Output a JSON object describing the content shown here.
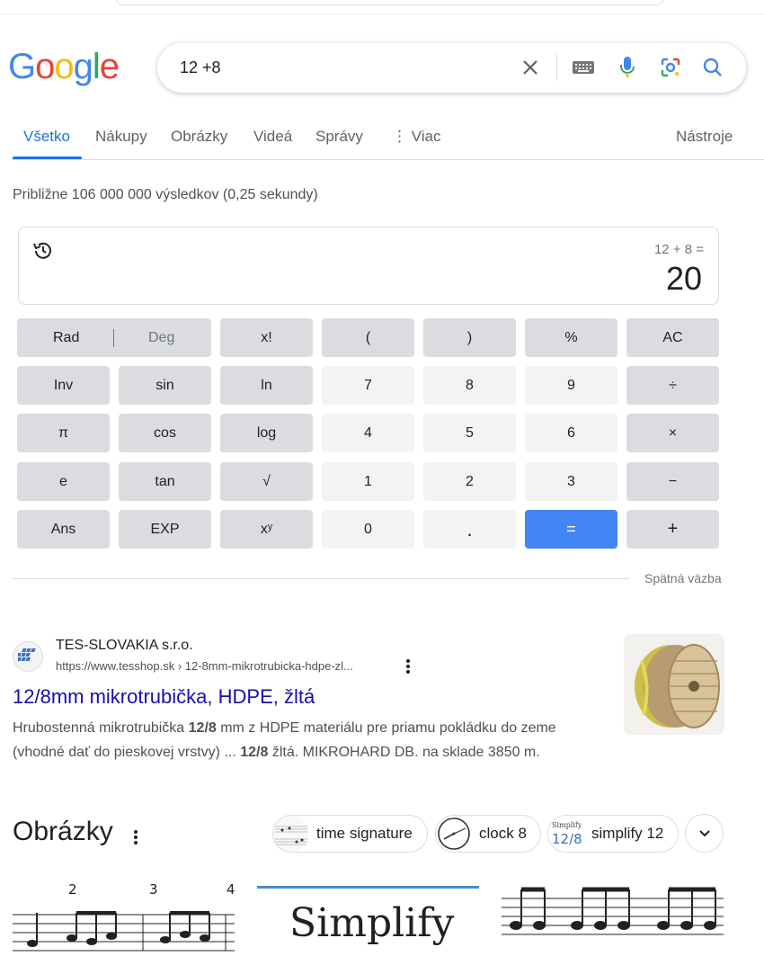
{
  "logo": {
    "letters": [
      "G",
      "o",
      "o",
      "g",
      "l",
      "e"
    ],
    "colors": [
      "#4285f4",
      "#ea4335",
      "#fbbc05",
      "#4285f4",
      "#34a853",
      "#ea4335"
    ]
  },
  "search": {
    "query": "12 +8",
    "icons": [
      "close-icon",
      "keyboard-icon",
      "mic-icon",
      "lens-icon",
      "search-icon"
    ]
  },
  "tabs": [
    {
      "label": "Všetko",
      "active": true
    },
    {
      "label": "Nákupy"
    },
    {
      "label": "Obrázky"
    },
    {
      "label": "Videá"
    },
    {
      "label": "Správy"
    },
    {
      "label": "Viac"
    },
    {
      "label": "Nástroje"
    }
  ],
  "result_stats": "Približne 106 000 000 výsledkov (0,25 sekundy)",
  "calculator": {
    "expression": "12 + 8 =",
    "result": "20",
    "rad": "Rad",
    "deg": "Deg",
    "keys": [
      [
        "x!",
        "(",
        ")",
        "%",
        "AC"
      ],
      [
        "Inv",
        "sin",
        "ln",
        "7",
        "8",
        "9",
        "÷"
      ],
      [
        "π",
        "cos",
        "log",
        "4",
        "5",
        "6",
        "×"
      ],
      [
        "e",
        "tan",
        "√",
        "1",
        "2",
        "3",
        "−"
      ],
      [
        "Ans",
        "EXP",
        "xʸ",
        "0",
        ".",
        "=",
        "+"
      ]
    ]
  },
  "feedback": "Spätná väzba",
  "result": {
    "site": "TES-SLOVAKIA s.r.o.",
    "url": "https://www.tesshop.sk › 12-8mm-mikrotrubicka-hdpe-zl...",
    "title": "12/8mm mikrotrubička, HDPE, žltá",
    "snippet_parts": [
      "Hrubostenná mikrotrubička ",
      "12/8",
      " mm z HDPE materiálu pre priamu pokládku do zeme (vhodné dať do pieskovej vrstvy) ... ",
      "12/8",
      " žltá. MIKROHARD DB. na sklade 3850 m."
    ]
  },
  "images": {
    "heading": "Obrázky",
    "chips": [
      "time signature",
      "clock 8",
      "simplify 12"
    ],
    "chip_thumb_text": [
      "Simplify",
      "12/8"
    ],
    "card_texts": [
      "2",
      "3",
      "4",
      "Simplify"
    ]
  },
  "colors": {
    "accent": "#1a73e8",
    "link": "#1a0dab",
    "equals_key": "#4285f4"
  }
}
